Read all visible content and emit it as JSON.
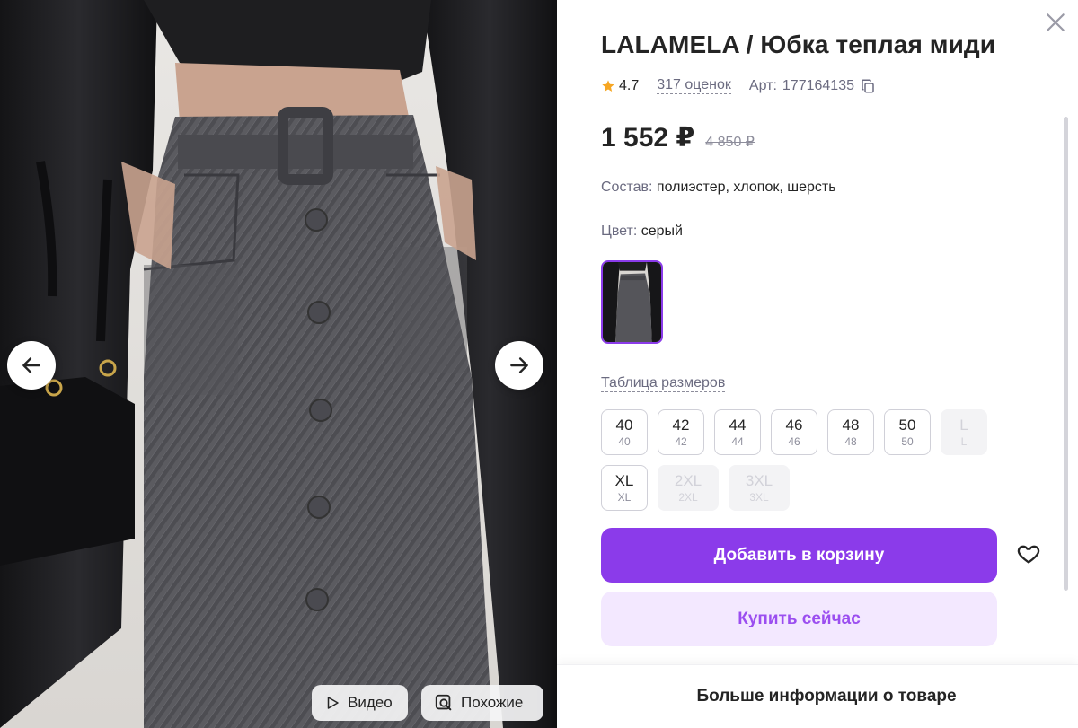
{
  "gallery": {
    "prev_icon": "arrow-left-icon",
    "next_icon": "arrow-right-icon",
    "video_label": "Видео",
    "similar_label": "Похожие"
  },
  "product": {
    "title": "LALAMELA / Юбка теплая миди",
    "rating": "4.7",
    "reviews": "317 оценок",
    "article_label": "Арт:",
    "article": "177164135",
    "price": "1 552 ₽",
    "old_price": "4 850 ₽",
    "composition_label": "Состав:",
    "composition": "полиэстер, хлопок, шерсть",
    "color_label": "Цвет:",
    "color": "серый",
    "size_table_label": "Таблица размеров",
    "sizes": [
      {
        "main": "40",
        "sub": "40",
        "available": true
      },
      {
        "main": "42",
        "sub": "42",
        "available": true
      },
      {
        "main": "44",
        "sub": "44",
        "available": true
      },
      {
        "main": "46",
        "sub": "46",
        "available": true
      },
      {
        "main": "48",
        "sub": "48",
        "available": true
      },
      {
        "main": "50",
        "sub": "50",
        "available": true
      },
      {
        "main": "L",
        "sub": "L",
        "available": false
      },
      {
        "main": "XL",
        "sub": "XL",
        "available": true
      },
      {
        "main": "2XL",
        "sub": "2XL",
        "available": false
      },
      {
        "main": "3XL",
        "sub": "3XL",
        "available": false
      }
    ],
    "add_to_cart": "Добавить в корзину",
    "buy_now": "Купить сейчас",
    "more_info": "Больше информации о товаре"
  },
  "colors": {
    "accent": "#8b3bea",
    "accent_light": "#f3e8ff",
    "star": "#f6a623",
    "text": "#242424",
    "muted": "#6b6b80"
  }
}
